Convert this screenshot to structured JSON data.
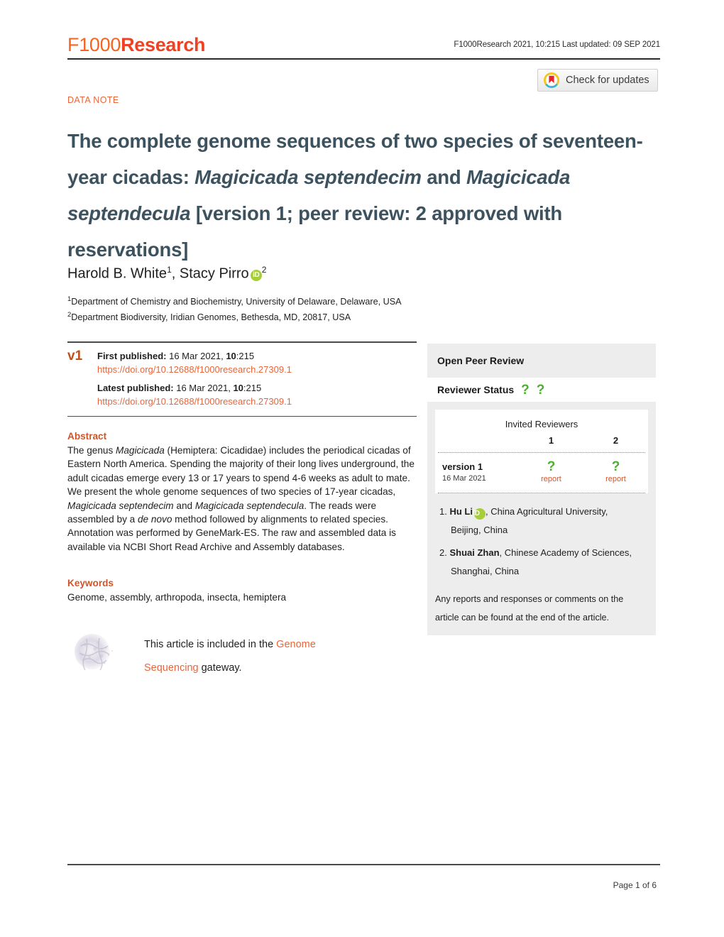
{
  "header": {
    "logo_f1000": "F1000",
    "logo_research": "Research",
    "meta": "F1000Research 2021, 10:215 Last updated: 09 SEP 2021",
    "crossmark_label": "Check for updates",
    "crossmark_icon": "crossmark-icon"
  },
  "article": {
    "type": "DATA NOTE",
    "title_line1": "The complete genome sequences of two species of seventeen-",
    "title_line2_pre": "year cicadas: ",
    "title_line2_italic1": "Magicicada septendecim",
    "title_line2_mid": " and ",
    "title_line2_italic2": "Magicicada",
    "title_line3_italic": "septendecula",
    "title_line3_rest": "[version 1; peer review: 2 approved with",
    "title_line4": "reservations]"
  },
  "authors": {
    "author1": "Harold B. White",
    "author1_sup": "1",
    "separator": ", ",
    "author2": "Stacy Pirro",
    "orcid_badge": "iD",
    "author2_sup": "2",
    "affiliation1_sup": "1",
    "affiliation1": "Department of Chemistry and Biochemistry, University of Delaware, Delaware, USA",
    "affiliation2_sup": "2",
    "affiliation2": "Department Biodiversity, Iridian Genomes, Bethesda, MD, 20817, USA"
  },
  "publication": {
    "version_tag": "v1",
    "first_published_label": "First published:",
    "first_published_date": " 16 Mar 2021, ",
    "first_published_vol": "10",
    "first_published_page": ":215",
    "first_doi": "https://doi.org/10.12688/f1000research.27309.1",
    "latest_published_label": "Latest published:",
    "latest_published_date": " 16 Mar 2021, ",
    "latest_published_vol": "10",
    "latest_published_page": ":215",
    "latest_doi": "https://doi.org/10.12688/f1000research.27309.1"
  },
  "abstract": {
    "heading": "Abstract",
    "p1": "The genus ",
    "i1": "Magicicada",
    "p2": " (Hemiptera: Cicadidae) includes the periodical cicadas of Eastern North America. Spending the majority of their long lives underground, the adult cicadas emerge every 13 or 17 years to spend 4-6 weeks as adult to mate. We present the whole genome sequences of two species of 17-year cicadas, ",
    "i2": "Magicicada septendecim",
    "p3": " and ",
    "i3": "Magicicada septendecula",
    "p4": ". The reads were assembled by a ",
    "i4": "de novo",
    "p5": " method followed by alignments to related species. Annotation was performed by GeneMark-ES. The raw and assembled data is available via NCBI Short Read Archive and Assembly databases."
  },
  "keywords": {
    "heading": "Keywords",
    "text": "Genome, assembly, arthropoda, insecta, hemiptera"
  },
  "gateway": {
    "pre": "This article is included in the ",
    "link1": "Genome",
    "link2": "Sequencing",
    "post": " gateway.",
    "thumb_icon": "gateway-thumbnail"
  },
  "peer_review": {
    "title": "Open Peer Review",
    "status_label": "Reviewer Status",
    "status_marks": [
      "?",
      "?"
    ],
    "invited_heading": "Invited Reviewers",
    "reviewer_numbers": [
      "1",
      "2"
    ],
    "version_name": "version 1",
    "version_date": "16 Mar 2021",
    "cells": [
      {
        "mark": "?",
        "report": "report"
      },
      {
        "mark": "?",
        "report": "report"
      }
    ],
    "reviewers": [
      {
        "index": "1.",
        "name": "Hu Li",
        "orcid": "iD",
        "affiliation": ", China Agricultural University,",
        "affiliation_line2": "Beijing, China"
      },
      {
        "index": "2.",
        "name": "Shuai Zhan",
        "orcid": "",
        "affiliation": ", Chinese Academy of Sciences,",
        "affiliation_line2": "Shanghai, China"
      }
    ],
    "note_line1": "Any reports and responses or comments on the",
    "note_line2": "article can be found at the end of the article."
  },
  "footer": {
    "page_label": "Page 1 of 6"
  },
  "colors": {
    "brand_orange": "#f26522",
    "link_orange": "#e8663a",
    "heading_orange": "#d1552a",
    "title_slate": "#3d525f",
    "orcid_green": "#a6ce39",
    "status_green": "#4caf2f",
    "panel_gray": "#ededed"
  }
}
